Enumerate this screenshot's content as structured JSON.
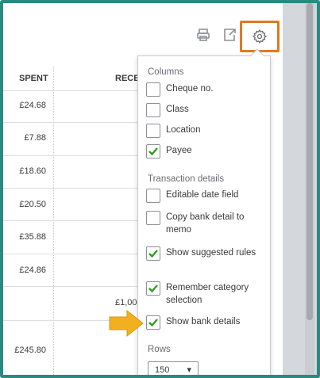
{
  "table": {
    "headers": {
      "spent": "SPENT",
      "received": "RECE"
    },
    "rows": [
      {
        "spent": "£24.68",
        "received": ""
      },
      {
        "spent": "£7.88",
        "received": ""
      },
      {
        "spent": "£18.60",
        "received": ""
      },
      {
        "spent": "£20.50",
        "received": ""
      },
      {
        "spent": "£35.88",
        "received": ""
      },
      {
        "spent": "£24.86",
        "received": ""
      },
      {
        "spent": "",
        "received": "£1,00"
      },
      {
        "spent": "£245.80",
        "received": ""
      }
    ]
  },
  "toolbar": {
    "print_icon": "print-icon",
    "export_icon": "export-icon",
    "gear_icon": "gear-icon",
    "highlight_color": "#e07a1f"
  },
  "settings_panel": {
    "columns_heading": "Columns",
    "columns": [
      {
        "label": "Cheque no.",
        "checked": false
      },
      {
        "label": "Class",
        "checked": false
      },
      {
        "label": "Location",
        "checked": false
      },
      {
        "label": "Payee",
        "checked": true
      }
    ],
    "transaction_heading": "Transaction details",
    "transaction_options": [
      {
        "label": "Editable date field",
        "checked": false
      },
      {
        "label": "Copy bank detail to memo",
        "checked": false
      },
      {
        "label": "Show suggested rules",
        "checked": true
      },
      {
        "label": "Remember category selection",
        "checked": true
      },
      {
        "label": "Show bank details",
        "checked": true
      }
    ],
    "rows_heading": "Rows",
    "rows_value": "150"
  },
  "colors": {
    "frame": "#2a8a82",
    "check": "#2ca01c",
    "arrow": "#f2b01e"
  }
}
